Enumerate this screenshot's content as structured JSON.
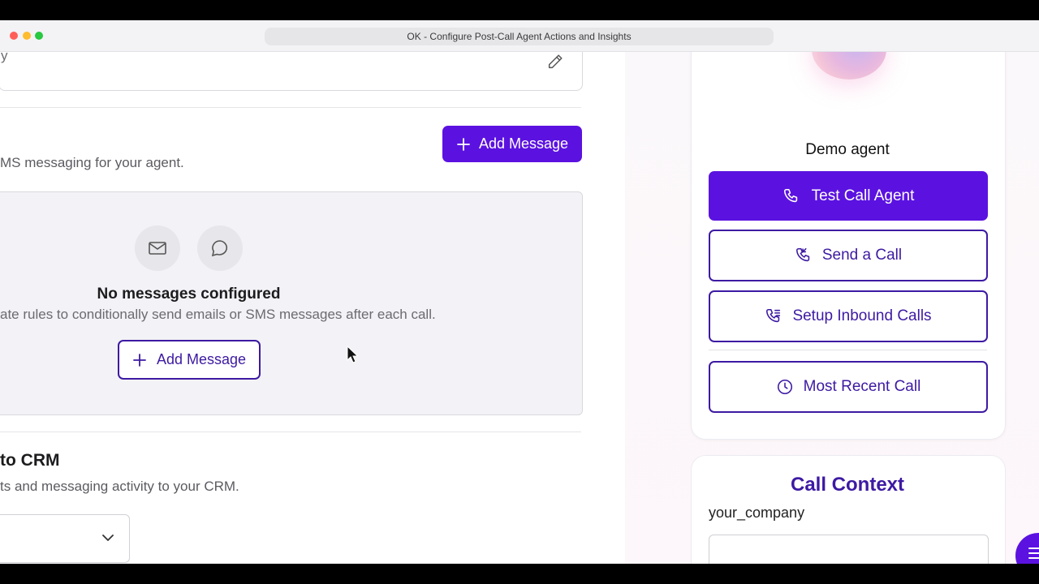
{
  "window": {
    "title": "OK - Configure Post-Call Agent Actions and Insights"
  },
  "top_card": {
    "value_fragment": "y"
  },
  "messages_section": {
    "description": "MS messaging for your agent.",
    "add_button_label": "Add Message",
    "empty_state": {
      "title": "No messages configured",
      "description": "ate rules to conditionally send emails or SMS messages after each call.",
      "add_button_label": "Add Message"
    }
  },
  "crm_section": {
    "title": "to CRM",
    "description": "ts and messaging activity to your CRM.",
    "select_value": ""
  },
  "agent_panel": {
    "agent_name": "Demo agent",
    "buttons": {
      "test_call": "Test Call Agent",
      "send_call": "Send a Call",
      "setup_inbound": "Setup Inbound Calls",
      "most_recent": "Most Recent Call"
    }
  },
  "call_context": {
    "title": "Call Context",
    "field_label": "your_company",
    "field_value": ""
  },
  "colors": {
    "primary": "#5b12e0",
    "outline": "#3d1aa3"
  }
}
